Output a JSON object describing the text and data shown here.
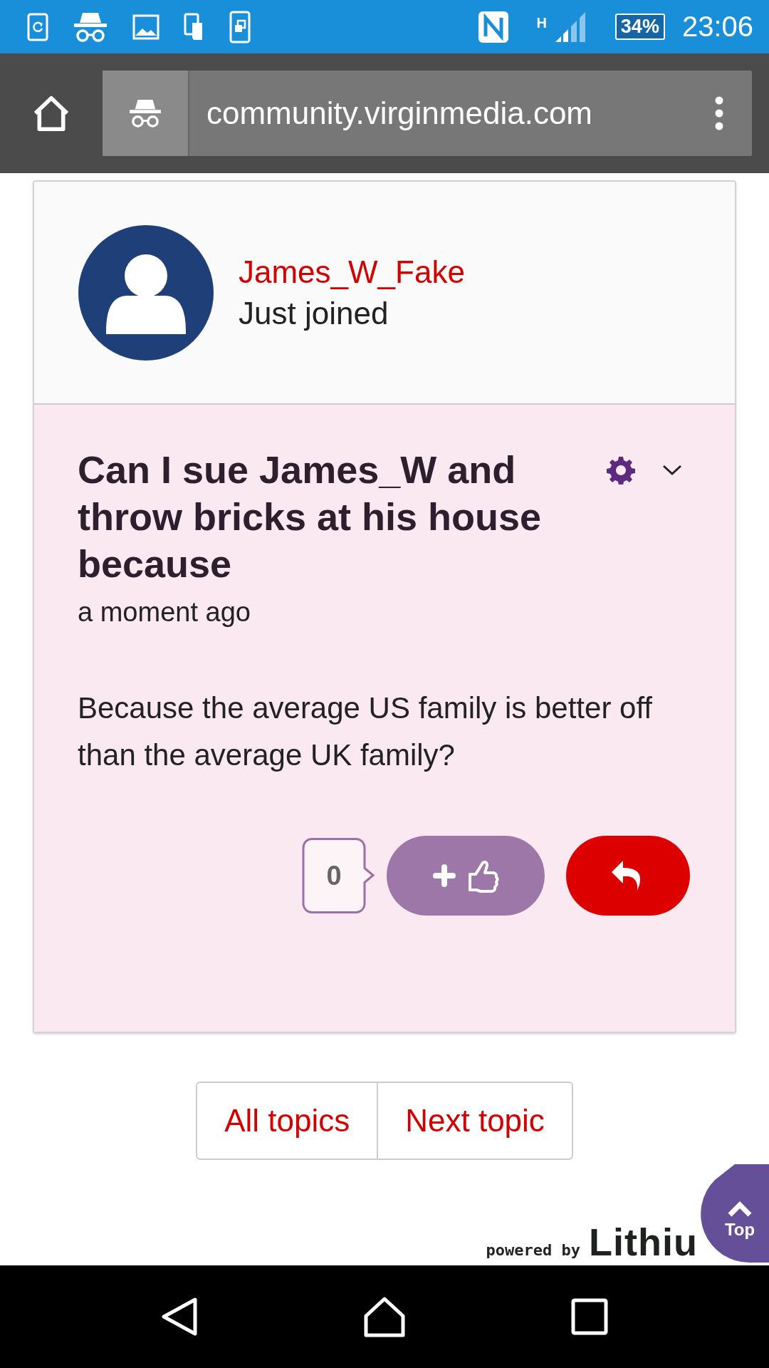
{
  "status_bar": {
    "network": "H",
    "battery": "34%",
    "time": "23:06"
  },
  "browser": {
    "url": "community.virginmedia.com"
  },
  "post": {
    "author": "James_W_Fake",
    "rank": "Just joined",
    "title": "Can I sue James_W and throw bricks at his house because",
    "time": "a moment ago",
    "body": "Because the average US family is better off than the average UK family?",
    "kudos_count": "0"
  },
  "pagination": [
    "All topics",
    "Next topic"
  ],
  "footer": {
    "powered_by": "powered by",
    "logo": "Lithiu",
    "top_button": "Top"
  }
}
